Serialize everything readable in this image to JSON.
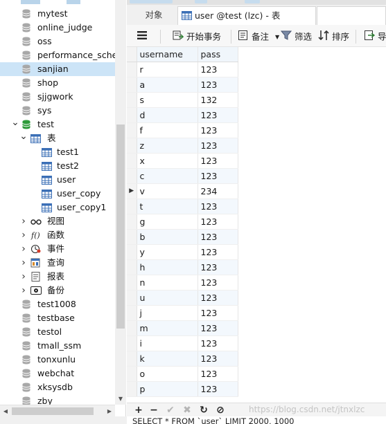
{
  "navigator": {
    "rows": [
      {
        "level": 0,
        "kind": "db",
        "label": "mytest"
      },
      {
        "level": 0,
        "kind": "db",
        "label": "online_judge"
      },
      {
        "level": 0,
        "kind": "db",
        "label": "oss"
      },
      {
        "level": 0,
        "kind": "db",
        "label": "performance_schen"
      },
      {
        "level": 0,
        "kind": "db",
        "label": "sanjian",
        "selected": true
      },
      {
        "level": 0,
        "kind": "db",
        "label": "shop"
      },
      {
        "level": 0,
        "kind": "db",
        "label": "sjjgwork"
      },
      {
        "level": 0,
        "kind": "db",
        "label": "sys"
      },
      {
        "level": 0,
        "kind": "db-open",
        "label": "test",
        "expanded": true
      },
      {
        "level": 1,
        "kind": "tables",
        "label": "表",
        "expanded": true
      },
      {
        "level": 2,
        "kind": "table",
        "label": "test1"
      },
      {
        "level": 2,
        "kind": "table",
        "label": "test2"
      },
      {
        "level": 2,
        "kind": "table",
        "label": "user"
      },
      {
        "level": 2,
        "kind": "table",
        "label": "user_copy"
      },
      {
        "level": 2,
        "kind": "table",
        "label": "user_copy1"
      },
      {
        "level": 1,
        "kind": "views",
        "label": "视图",
        "expanded": false
      },
      {
        "level": 1,
        "kind": "functions",
        "label": "函数",
        "expanded": false
      },
      {
        "level": 1,
        "kind": "events",
        "label": "事件",
        "expanded": false
      },
      {
        "level": 1,
        "kind": "queries",
        "label": "查询",
        "expanded": false
      },
      {
        "level": 1,
        "kind": "reports",
        "label": "报表",
        "expanded": false
      },
      {
        "level": 1,
        "kind": "backups",
        "label": "备份",
        "expanded": false
      },
      {
        "level": 0,
        "kind": "db",
        "label": "test1008"
      },
      {
        "level": 0,
        "kind": "db",
        "label": "testbase"
      },
      {
        "level": 0,
        "kind": "db",
        "label": "testol"
      },
      {
        "level": 0,
        "kind": "db",
        "label": "tmall_ssm"
      },
      {
        "level": 0,
        "kind": "db",
        "label": "tonxunlu"
      },
      {
        "level": 0,
        "kind": "db",
        "label": "webchat"
      },
      {
        "level": 0,
        "kind": "db",
        "label": "xksysdb"
      },
      {
        "level": 0,
        "kind": "db",
        "label": "zby"
      }
    ]
  },
  "tabs": {
    "objects": "对象",
    "active": "user @test (lzc) - 表"
  },
  "toolbar": {
    "begin_transaction": "开始事务",
    "memo": "备注",
    "filter": "筛选",
    "sort": "排序",
    "import": "导"
  },
  "grid": {
    "columns": [
      "username",
      "pass"
    ],
    "current_row_index": 9,
    "rows": [
      [
        "r",
        "123"
      ],
      [
        "a",
        "123"
      ],
      [
        "s",
        "132"
      ],
      [
        "d",
        "123"
      ],
      [
        "f",
        "123"
      ],
      [
        "z",
        "123"
      ],
      [
        "x",
        "123"
      ],
      [
        "c",
        "123"
      ],
      [
        "v",
        "234"
      ],
      [
        "t",
        "123"
      ],
      [
        "g",
        "123"
      ],
      [
        "b",
        "123"
      ],
      [
        "y",
        "123"
      ],
      [
        "h",
        "123"
      ],
      [
        "n",
        "123"
      ],
      [
        "u",
        "123"
      ],
      [
        "j",
        "123"
      ],
      [
        "m",
        "123"
      ],
      [
        "i",
        "123"
      ],
      [
        "k",
        "123"
      ],
      [
        "o",
        "123"
      ],
      [
        "p",
        "123"
      ]
    ]
  },
  "bottombar": {
    "add": "+",
    "delete": "−",
    "apply": "✔",
    "discard": "✖",
    "refresh": "↻",
    "stop": "⊘",
    "watermark": "https://blog.csdn.net/jtnxlzc"
  },
  "statusbar": {
    "sql": "SELECT * FROM `user` LIMIT 2000, 1000"
  },
  "colors": {
    "selection": "#cce4f7",
    "header_bg": "#f0f6fb",
    "alt_row": "#f3f8fd",
    "db_icon": "#9a9a9a",
    "db_open_icon": "#2e9b3a",
    "table_icon": "#3b6fb6"
  }
}
